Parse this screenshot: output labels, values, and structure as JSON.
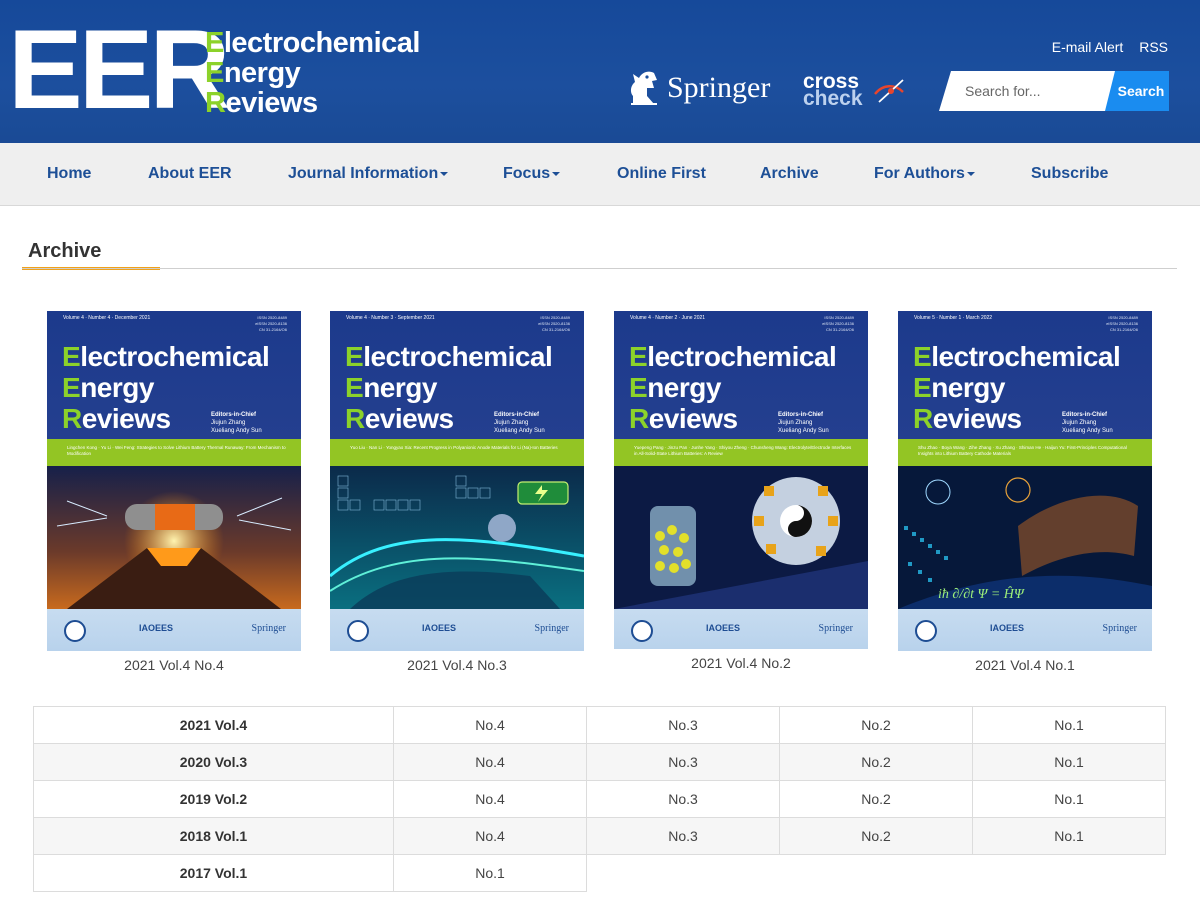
{
  "header": {
    "logo_short": "EER",
    "logo_words": [
      {
        "cap": "E",
        "rest": "lectrochemical"
      },
      {
        "cap": "E",
        "rest": "nergy"
      },
      {
        "cap": "R",
        "rest": "eviews"
      }
    ],
    "links": [
      "E-mail Alert",
      "RSS"
    ],
    "springer_label": "Springer",
    "crosscheck_top": "cross",
    "crosscheck_bottom": "check",
    "search_placeholder": "Search for...",
    "search_button": "Search"
  },
  "nav": {
    "items": [
      {
        "label": "Home",
        "dropdown": false
      },
      {
        "label": "About EER",
        "dropdown": false
      },
      {
        "label": "Journal Information",
        "dropdown": true
      },
      {
        "label": "Focus",
        "dropdown": true
      },
      {
        "label": "Online First",
        "dropdown": false
      },
      {
        "label": "Archive",
        "dropdown": false
      },
      {
        "label": "For Authors",
        "dropdown": true
      },
      {
        "label": "Subscribe",
        "dropdown": false
      }
    ]
  },
  "section": {
    "title": "Archive"
  },
  "covers": [
    {
      "caption": "2021 Vol.4 No.4",
      "meta": "Volume 4 · Number 4 · December 2021",
      "issn": [
        "ISSN 2520-8489",
        "eISSN 2520-8136",
        "CN 31-2164/O6"
      ],
      "title_lines": [
        {
          "cap": "E",
          "rest": "lectrochemical"
        },
        {
          "cap": "E",
          "rest": "nergy"
        },
        {
          "cap": "R",
          "rest": "eviews"
        }
      ],
      "editors": [
        "Editors-in-Chief",
        "Jiujun Zhang",
        "Xueliang Andy Sun"
      ],
      "band": "Lingchen Kong · Yu Li · Wei Feng: Strategies to Solve Lithium Battery Thermal Runaway: From Mechanism to Modification",
      "art": "volcano",
      "foot": {
        "mid": "IAOEES",
        "right": "Springer"
      }
    },
    {
      "caption": "2021 Vol.4 No.3",
      "meta": "Volume 4 · Number 3 · September 2021",
      "issn": [
        "ISSN 2520-8489",
        "eISSN 2520-8136",
        "CN 31-2164/O6"
      ],
      "title_lines": [
        {
          "cap": "E",
          "rest": "lectrochemical"
        },
        {
          "cap": "E",
          "rest": "nergy"
        },
        {
          "cap": "R",
          "rest": "eviews"
        }
      ],
      "editors": [
        "Editors-in-Chief",
        "Jiujun Zhang",
        "Xueliang Andy Sun"
      ],
      "band": "Yuo Liu · Nan Li · Yongyao Xia: Recent Progress in Polyanionic Anode Materials for Li (Na)-Ion Batteries",
      "art": "car",
      "foot": {
        "mid": "IAOEES",
        "right": "Springer"
      }
    },
    {
      "caption": "2021 Vol.4 No.2",
      "meta": "Volume 4 · Number 2 · June 2021",
      "issn": [
        "ISSN 2520-8489",
        "eISSN 2520-8136",
        "CN 31-2164/O6"
      ],
      "title_lines": [
        {
          "cap": "E",
          "rest": "lectrochemical"
        },
        {
          "cap": "E",
          "rest": "nergy"
        },
        {
          "cap": "R",
          "rest": "eviews"
        }
      ],
      "editors": [
        "Editors-in-Chief",
        "Jiujun Zhang",
        "Xueliang Andy Sun"
      ],
      "band": "Yuepeng Pang · Jinzu Pan · Junhe Yang · Shiyou Zheng · Chunsheng Wang: Electrolyte/Electrode Interfaces in All-Solid-State Lithium Batteries: A Review",
      "art": "yinyang",
      "foot": {
        "mid": "IAOEES",
        "right": "Springer"
      }
    },
    {
      "caption": "2021 Vol.4 No.1",
      "meta": "Volume 5 · Number 1 · March 2022",
      "issn": [
        "ISSN 2520-8489",
        "eISSN 2520-8136",
        "CN 31-2164/O6"
      ],
      "title_lines": [
        {
          "cap": "E",
          "rest": "lectrochemical"
        },
        {
          "cap": "E",
          "rest": "nergy"
        },
        {
          "cap": "R",
          "rest": "eviews"
        }
      ],
      "editors": [
        "Editors-in-Chief",
        "Jiujun Zhang",
        "Xueliang Andy Sun"
      ],
      "band": "Shu Zhao · Boya Wang · Zihe Zhang · Xu Zhang · Shiman He · Haijun Yu: First-Principles Computational Insights into Lithium Battery Cathode Materials",
      "art": "quantum",
      "foot": {
        "mid": "IAOEES",
        "right": "Springer"
      }
    }
  ],
  "archive_rows": [
    {
      "volume": "2021 Vol.4",
      "issues": [
        "No.4",
        "No.3",
        "No.2",
        "No.1"
      ]
    },
    {
      "volume": "2020 Vol.3",
      "issues": [
        "No.4",
        "No.3",
        "No.2",
        "No.1"
      ]
    },
    {
      "volume": "2019 Vol.2",
      "issues": [
        "No.4",
        "No.3",
        "No.2",
        "No.1"
      ]
    },
    {
      "volume": "2018 Vol.1",
      "issues": [
        "No.4",
        "No.3",
        "No.2",
        "No.1"
      ]
    },
    {
      "volume": "2017 Vol.1",
      "issues": [
        "No.1"
      ]
    }
  ],
  "colors": {
    "header_blue": "#1c4f9e",
    "nav_text": "#1d4f96",
    "logo_green": "#8cd22a",
    "search_button": "#1a8cf0",
    "section_accent": "#f0a21b",
    "cover_band": "#93c524"
  },
  "icons": {
    "springer": "springer-horse-icon",
    "crosscheck": "crosscheck-logo-icon"
  }
}
